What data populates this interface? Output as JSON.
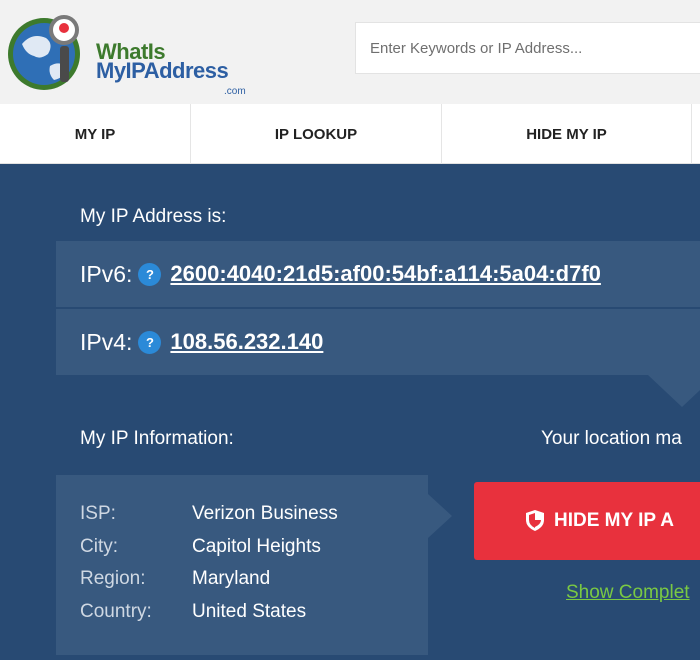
{
  "header": {
    "logo": {
      "line1": "WhatIs",
      "line2": "MyIPAddress",
      "suffix": ".com"
    },
    "search": {
      "placeholder": "Enter Keywords or IP Address..."
    }
  },
  "nav": {
    "items": [
      {
        "label": "MY IP"
      },
      {
        "label": "IP LOOKUP"
      },
      {
        "label": "HIDE MY IP"
      }
    ]
  },
  "main": {
    "ip_heading": "My IP Address is:",
    "ipv6": {
      "label": "IPv6:",
      "value": "2600:4040:21d5:af00:54bf:a114:5a04:d7f0"
    },
    "ipv4": {
      "label": "IPv4:",
      "value": "108.56.232.140"
    },
    "info_heading": "My IP Information:",
    "location_text": "Your location ma",
    "info": [
      {
        "key": "ISP:",
        "value": "Verizon Business"
      },
      {
        "key": "City:",
        "value": "Capitol Heights"
      },
      {
        "key": "Region:",
        "value": "Maryland"
      },
      {
        "key": "Country:",
        "value": "United States"
      }
    ],
    "hide_button": "HIDE MY IP A",
    "show_link": "Show Complet"
  },
  "colors": {
    "panel": "#284a73",
    "panel_box": "#38597f",
    "accent_red": "#e8313d",
    "link_green": "#7ac943",
    "help_blue": "#2b8ad8"
  },
  "icons": [
    "globe-magnifier-logo-icon",
    "help-icon",
    "shield-icon"
  ]
}
